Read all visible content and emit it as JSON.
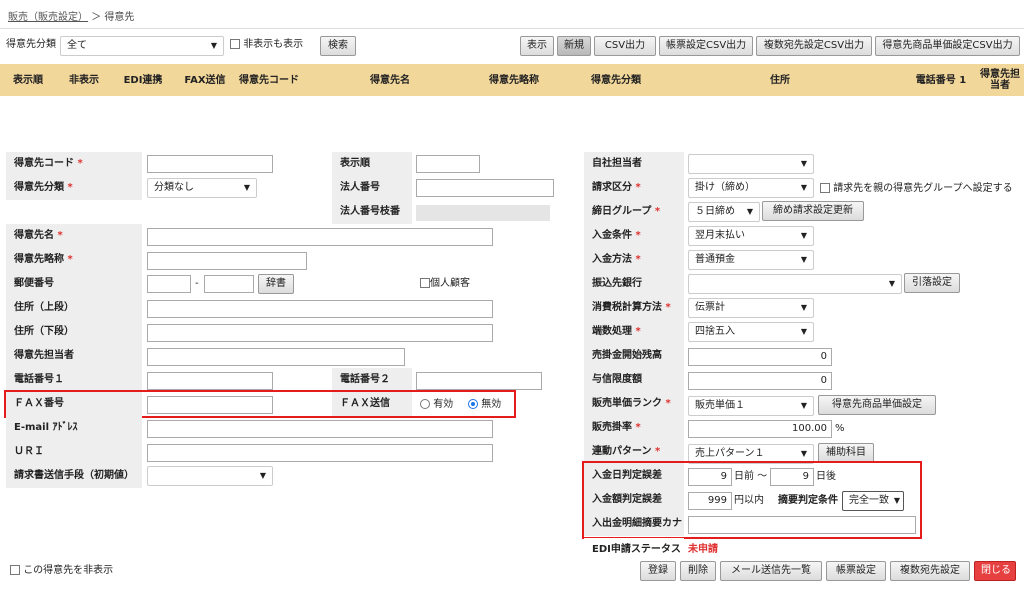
{
  "breadcrumb": {
    "parent": "販売（販売設定）",
    "sep": "＞",
    "current": "得意先"
  },
  "filter": {
    "label": "得意先分類",
    "value": "全て",
    "show_hidden_label": "非表示も表示",
    "search_label": "検索"
  },
  "toolbar": {
    "display": "表示",
    "new": "新規",
    "csv": "CSV出力",
    "form_csv": "帳票設定CSV出力",
    "multi_csv": "複数宛先設定CSV出力",
    "price_csv": "得意先商品単価設定CSV出力"
  },
  "table": {
    "headers": [
      "表示順",
      "非表示",
      "EDI連携",
      "FAX送信",
      "得意先コード",
      "得意先名",
      "得意先略称",
      "得意先分類",
      "住所",
      "電話番号 1",
      "得意先担当者"
    ]
  },
  "form": {
    "code": {
      "label": "得意先コード",
      "req": "*",
      "value": ""
    },
    "category": {
      "label": "得意先分類",
      "req": "*",
      "value": "分類なし"
    },
    "display_order": {
      "label": "表示順",
      "value": ""
    },
    "corp_no": {
      "label": "法人番号",
      "value": ""
    },
    "corp_branch": {
      "label": "法人番号枝番"
    },
    "name": {
      "label": "得意先名",
      "req": "*",
      "value": ""
    },
    "short_name": {
      "label": "得意先略称",
      "req": "*",
      "value": ""
    },
    "postal": {
      "label": "郵便番号",
      "dash": "-",
      "dict_button": "辞書"
    },
    "individual": {
      "label": "個人顧客"
    },
    "addr1": {
      "label": "住所（上段）",
      "value": ""
    },
    "addr2": {
      "label": "住所（下段）",
      "value": ""
    },
    "person": {
      "label": "得意先担当者",
      "value": ""
    },
    "tel1": {
      "label": "電話番号１",
      "value": ""
    },
    "tel2": {
      "label": "電話番号２",
      "value": ""
    },
    "fax": {
      "label": "ＦＡＸ番号",
      "value": ""
    },
    "fax_send": {
      "label": "ＦＡＸ送信",
      "opt_on": "有効",
      "opt_off": "無効",
      "selected": "無効"
    },
    "email": {
      "label": "E-mail ｱﾄﾞﾚｽ",
      "value": ""
    },
    "url": {
      "label": "ＵＲＩ",
      "value": ""
    },
    "invoice_method": {
      "label": "請求書送信手段（初期値）",
      "value": ""
    },
    "hide_customer": {
      "label": "この得意先を非表示"
    }
  },
  "right": {
    "staff": {
      "label": "自社担当者",
      "value": ""
    },
    "billing": {
      "label": "請求区分",
      "req": "*",
      "value": "掛け（締め）",
      "group_label": "請求先を親の得意先グループへ設定する"
    },
    "closing": {
      "label": "締日グループ",
      "req": "*",
      "value": "５日締め",
      "update_button": "締め請求設定更新"
    },
    "payment_terms": {
      "label": "入金条件",
      "req": "*",
      "value": "翌月末払い"
    },
    "payment_method": {
      "label": "入金方法",
      "req": "*",
      "value": "普通預金"
    },
    "bank": {
      "label": "振込先銀行",
      "value": "",
      "button": "引落設定"
    },
    "tax_calc": {
      "label": "消費税計算方法",
      "req": "*",
      "value": "伝票計"
    },
    "rounding": {
      "label": "端数処理",
      "req": "*",
      "value": "四捨五入"
    },
    "ar_balance": {
      "label": "売掛金開始残高",
      "value": "0"
    },
    "credit": {
      "label": "与信限度額",
      "value": "0"
    },
    "price_rank": {
      "label": "販売単価ランク",
      "req": "*",
      "value": "販売単価１",
      "button": "得意先商品単価設定"
    },
    "sales_rate": {
      "label": "販売掛率",
      "req": "*",
      "value": "100.00",
      "unit": "%"
    },
    "link_pattern": {
      "label": "連動パターン",
      "req": "*",
      "value": "売上パターン１",
      "button": "補助科目"
    },
    "date_tol": {
      "label": "入金日判定誤差",
      "before": "9",
      "before_unit": "日前 ～",
      "after": "9",
      "after_unit": "日後"
    },
    "amount_tol": {
      "label": "入金額判定誤差",
      "value": "999",
      "unit": "円以内",
      "cond_label": "摘要判定条件",
      "cond_value": "完全一致"
    },
    "kana": {
      "label": "入出金明細摘要カナ",
      "value": ""
    },
    "edi": {
      "label": "EDI申請ステータス",
      "value": "未申請",
      "color": "#e03030"
    }
  },
  "footer": {
    "register": "登録",
    "delete": "削除",
    "mail_list": "メール送信先一覧",
    "form_settings": "帳票設定",
    "multi_dest": "複数宛先設定",
    "close": "閉じる"
  }
}
